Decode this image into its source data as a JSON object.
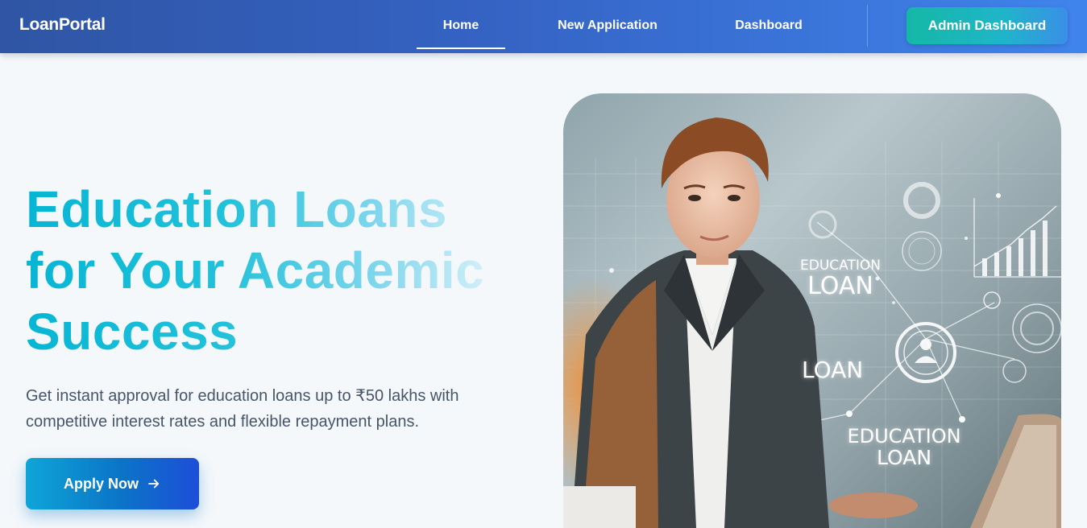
{
  "nav": {
    "brand": "LoanPortal",
    "links": [
      {
        "label": "Home",
        "active": true
      },
      {
        "label": "New Application",
        "active": false
      },
      {
        "label": "Dashboard",
        "active": false
      }
    ],
    "admin_label": "Admin Dashboard"
  },
  "hero": {
    "title_line1": "Education Loans",
    "title_line2": "for Your Academic",
    "title_line3": "Success",
    "subtitle_line1": "Get instant approval for education loans up to ₹50 lakhs with",
    "subtitle_line2": "competitive interest rates and flexible repayment plans.",
    "cta_label": "Apply Now",
    "cta_icon": "arrow-right-icon"
  },
  "illustration": {
    "label1_small": "EDUCATION",
    "label1_big": "LOAN",
    "label2": "LOAN",
    "label3_line1": "EDUCATION",
    "label3_line2": "LOAN"
  },
  "colors": {
    "nav_start": "#2f55a4",
    "nav_end": "#3f84ec",
    "admin_button": "#14b8a6",
    "title_accent": "#06b6d4",
    "cta_start": "#0ea5d8",
    "cta_end": "#1d4ed8",
    "page_bg": "#f4f8fb"
  }
}
